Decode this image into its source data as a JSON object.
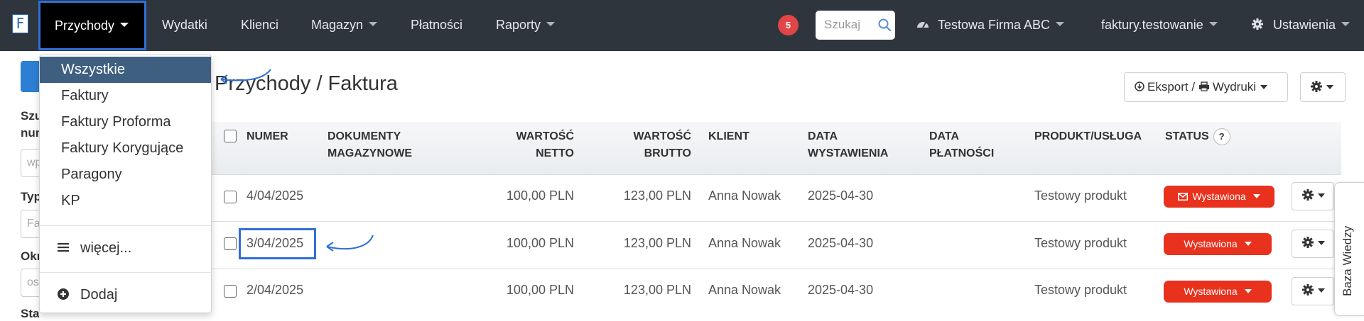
{
  "nav": {
    "logo": "F",
    "active_label": "Przychody",
    "items": [
      "Wydatki",
      "Klienci",
      "Magazyn",
      "Płatności",
      "Raporty"
    ],
    "notification_count": "5",
    "search_placeholder": "Szukaj",
    "company": "Testowa Firma ABC",
    "account": "faktury.testowanie",
    "settings": "Ustawienia"
  },
  "dropdown": {
    "items": [
      "Wszystkie",
      "Faktury",
      "Faktury Proforma",
      "Faktury Korygujące",
      "Paragony",
      "KP"
    ],
    "more": "więcej...",
    "add": "Dodaj"
  },
  "left_panel": {
    "label_search": "Szukaj numer",
    "search_value": "wpisz",
    "label_type": "Typ",
    "type_value": "Faktury",
    "label_period": "Okres",
    "period_value": "ostatnie",
    "label_status": "Status"
  },
  "page": {
    "title": "Przychody / Faktura",
    "export_label": "Eksport / ",
    "print_label": "Wydruki"
  },
  "table": {
    "headers": {
      "number": "NUMER",
      "docs_1": "DOKUMENTY",
      "docs_2": "MAGAZYNOWE",
      "net_1": "WARTOŚĆ",
      "net_2": "NETTO",
      "gross_1": "WARTOŚĆ",
      "gross_2": "BRUTTO",
      "client": "KLIENT",
      "issue_1": "DATA",
      "issue_2": "WYSTAWIENIA",
      "pay_1": "DATA",
      "pay_2": "PŁATNOŚCI",
      "product": "PRODUKT/USŁUGA",
      "status": "STATUS",
      "help": "?"
    },
    "rows": [
      {
        "number": "4/04/2025",
        "net": "100,00 PLN",
        "gross": "123,00 PLN",
        "client": "Anna Nowak",
        "issue_date": "2025-04-30",
        "product": "Testowy produkt",
        "status": "Wystawiona"
      },
      {
        "number": "3/04/2025",
        "net": "100,00 PLN",
        "gross": "123,00 PLN",
        "client": "Anna Nowak",
        "issue_date": "2025-04-30",
        "product": "Testowy produkt",
        "status": "Wystawiona"
      },
      {
        "number": "2/04/2025",
        "net": "100,00 PLN",
        "gross": "123,00 PLN",
        "client": "Anna Nowak",
        "issue_date": "2025-04-30",
        "product": "Testowy produkt",
        "status": "Wystawiona"
      }
    ]
  },
  "knowledge_tab": "Baza Wiedzy",
  "colors": {
    "nav_bg": "#2e353d",
    "highlight": "#2f6fd6",
    "status_red": "#e8321e",
    "dropdown_active": "#3e5f80"
  }
}
